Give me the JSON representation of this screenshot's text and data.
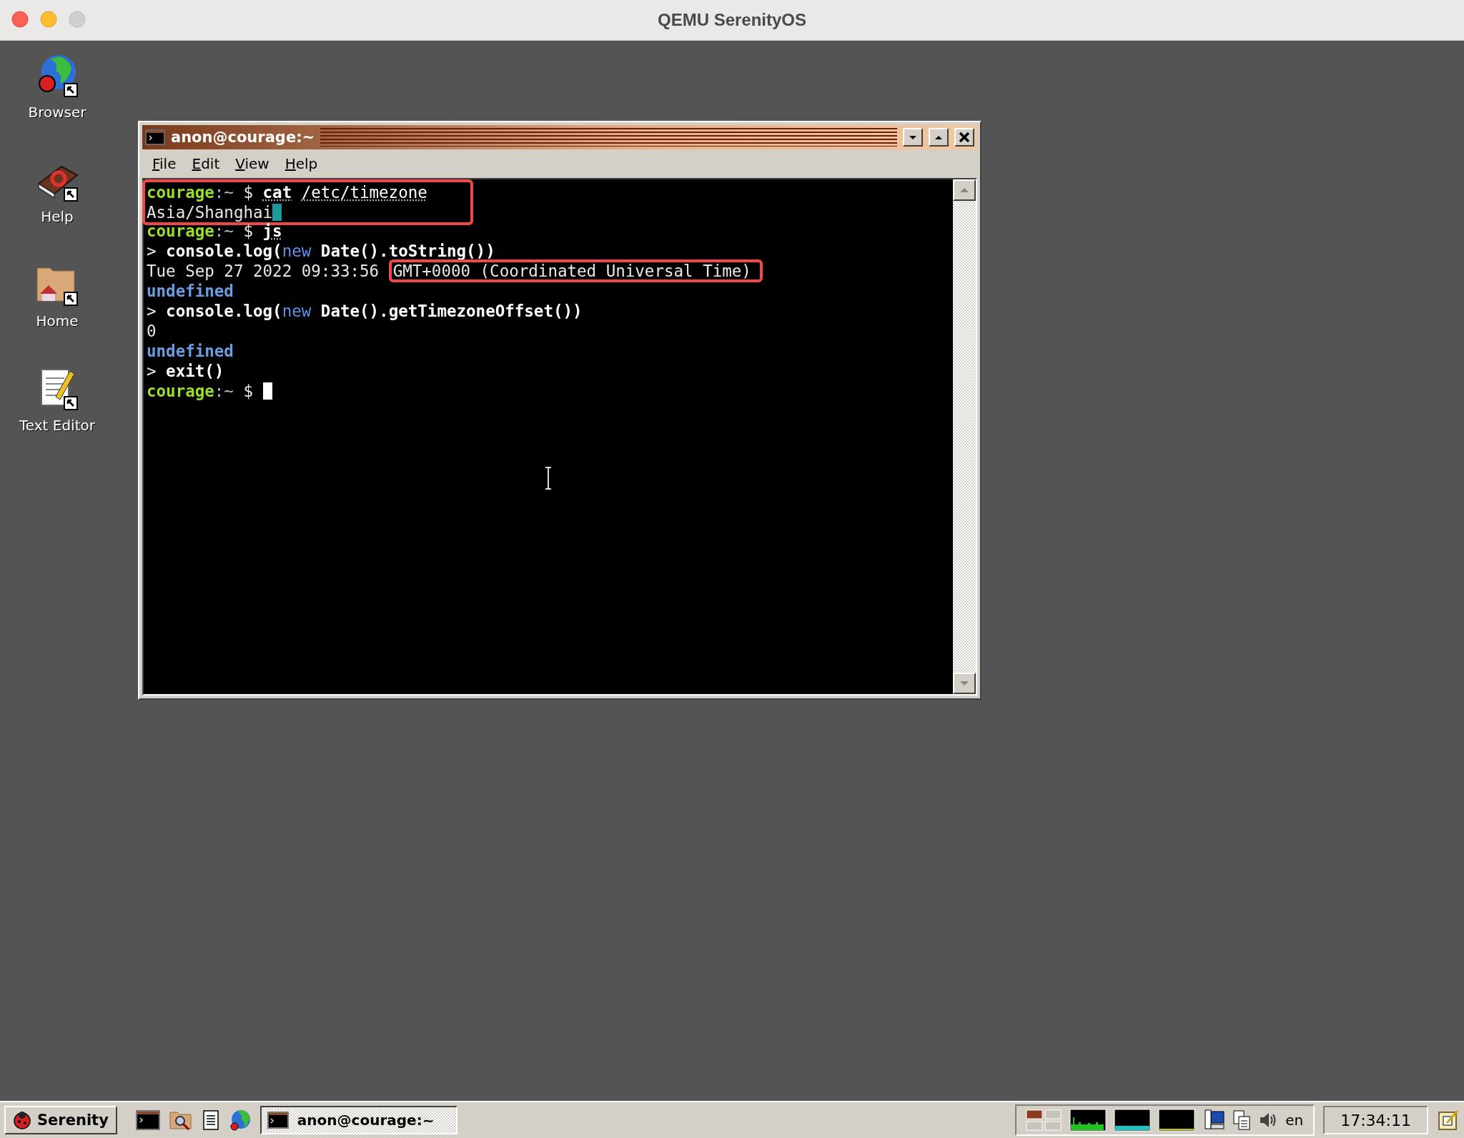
{
  "host_window": {
    "title": "QEMU SerenityOS"
  },
  "desktop_icons": [
    {
      "label": "Browser",
      "kind": "browser"
    },
    {
      "label": "Help",
      "kind": "help"
    },
    {
      "label": "Home",
      "kind": "home"
    },
    {
      "label": "Text Editor",
      "kind": "editor"
    }
  ],
  "terminal": {
    "title": "anon@courage:~",
    "menu": [
      "File",
      "Edit",
      "View",
      "Help"
    ],
    "blocks": [
      {
        "boxed": true,
        "lines": [
          {
            "segments": [
              {
                "kind": "host",
                "text": "courage"
              },
              {
                "kind": "path",
                "text": ":~"
              },
              {
                "kind": "text",
                "text": " $ "
              },
              {
                "kind": "command",
                "text": "cat"
              },
              {
                "kind": "arg",
                "text": "/etc/timezone"
              }
            ]
          },
          {
            "segments": [
              {
                "kind": "text",
                "text": "Asia/Shanghai"
              }
            ],
            "end_marker": true
          }
        ]
      },
      {
        "boxed": false,
        "lines": [
          {
            "segments": [
              {
                "kind": "host",
                "text": "courage"
              },
              {
                "kind": "path",
                "text": ":~"
              },
              {
                "kind": "text",
                "text": " $ "
              },
              {
                "kind": "command",
                "text": "js"
              }
            ]
          },
          {
            "segments": [
              {
                "kind": "text",
                "text": "> "
              },
              {
                "kind": "bold",
                "text": "console.log("
              },
              {
                "kind": "keyword",
                "text": "new"
              },
              {
                "kind": "bold",
                "text": " Date().toString())"
              }
            ]
          },
          {
            "segments": [
              {
                "kind": "text",
                "text": "Tue Sep 27 2022 09:33:56 "
              },
              {
                "kind": "text",
                "text": "GMT+0000 (Coordinated Universal Time)",
                "boxed": true
              }
            ]
          },
          {
            "segments": [
              {
                "kind": "result",
                "text": "undefined"
              }
            ]
          },
          {
            "segments": [
              {
                "kind": "text",
                "text": "> "
              },
              {
                "kind": "bold",
                "text": "console.log("
              },
              {
                "kind": "keyword",
                "text": "new"
              },
              {
                "kind": "bold",
                "text": " Date().getTimezoneOffset())"
              }
            ]
          },
          {
            "segments": [
              {
                "kind": "text",
                "text": "0"
              }
            ]
          },
          {
            "segments": [
              {
                "kind": "result",
                "text": "undefined"
              }
            ]
          },
          {
            "segments": [
              {
                "kind": "text",
                "text": "> "
              },
              {
                "kind": "bold",
                "text": "exit()"
              }
            ]
          },
          {
            "segments": [
              {
                "kind": "host",
                "text": "courage"
              },
              {
                "kind": "path",
                "text": ":~"
              },
              {
                "kind": "text",
                "text": " $ "
              }
            ],
            "cursor": true
          }
        ]
      }
    ]
  },
  "taskbar": {
    "start": "Serenity",
    "quick_launch": [
      {
        "kind": "terminal"
      },
      {
        "kind": "files"
      },
      {
        "kind": "notepad"
      },
      {
        "kind": "browser"
      }
    ],
    "tasks": [
      {
        "label": "anon@courage:~",
        "selected": true
      }
    ],
    "keyboard_layout": "en",
    "clock": "17:34:11"
  }
}
